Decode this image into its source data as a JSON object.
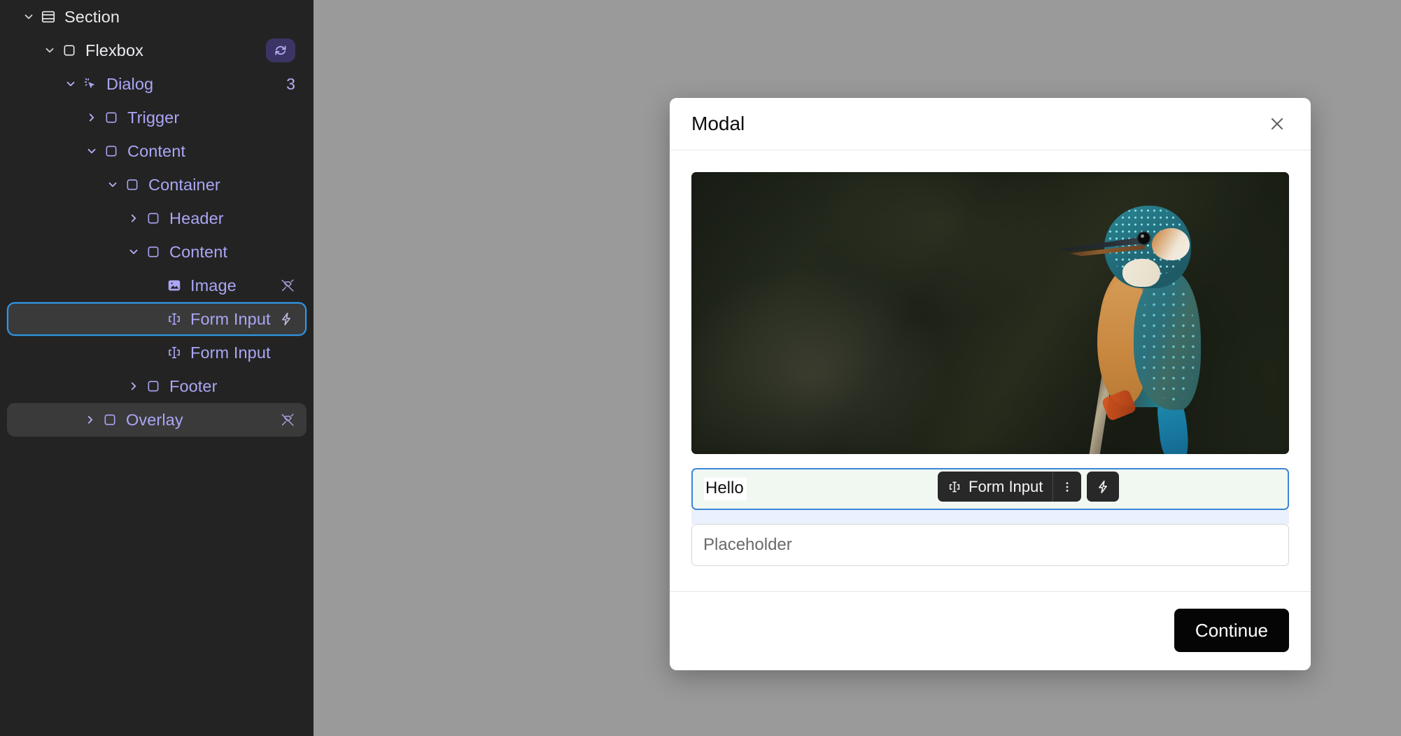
{
  "sidebar": {
    "tree": [
      {
        "label": "Section",
        "icon": "section-icon",
        "twisty": "down",
        "indent": 0,
        "state": "root",
        "trailing": null,
        "count": null
      },
      {
        "label": "Flexbox",
        "icon": "box-icon",
        "twisty": "down",
        "indent": 1,
        "state": "normal",
        "trailing": "refresh-badge",
        "count": null
      },
      {
        "label": "Dialog",
        "icon": "cursor-click-icon",
        "twisty": "down",
        "indent": 2,
        "state": "normal",
        "trailing": null,
        "count": "3"
      },
      {
        "label": "Trigger",
        "icon": "box-icon",
        "twisty": "right",
        "indent": 3,
        "state": "normal",
        "trailing": null,
        "count": null
      },
      {
        "label": "Content",
        "icon": "box-icon",
        "twisty": "down",
        "indent": 3,
        "state": "normal",
        "trailing": null,
        "count": null
      },
      {
        "label": "Container",
        "icon": "box-icon",
        "twisty": "down",
        "indent": 4,
        "state": "normal",
        "trailing": null,
        "count": null
      },
      {
        "label": "Header",
        "icon": "box-icon",
        "twisty": "right",
        "indent": 5,
        "state": "normal",
        "trailing": null,
        "count": null
      },
      {
        "label": "Content",
        "icon": "box-icon",
        "twisty": "down",
        "indent": 5,
        "state": "normal",
        "trailing": null,
        "count": null
      },
      {
        "label": "Image",
        "icon": "image-icon",
        "twisty": "none",
        "indent": 6,
        "state": "normal",
        "trailing": "unplug-icon",
        "count": null
      },
      {
        "label": "Form Input",
        "icon": "form-input-icon",
        "twisty": "none",
        "indent": 6,
        "state": "selected",
        "trailing": "bolt-icon",
        "count": null
      },
      {
        "label": "Form Input",
        "icon": "form-input-icon",
        "twisty": "none",
        "indent": 6,
        "state": "normal",
        "trailing": null,
        "count": null
      },
      {
        "label": "Footer",
        "icon": "box-icon",
        "twisty": "right",
        "indent": 5,
        "state": "normal",
        "trailing": null,
        "count": null
      },
      {
        "label": "Overlay",
        "icon": "box-icon",
        "twisty": "right",
        "indent": 3,
        "state": "hovered",
        "trailing": "unplug-icon",
        "count": null
      }
    ]
  },
  "canvas": {
    "background_color": "#9a9a9a",
    "guide_color": "#6a6ad1"
  },
  "modal": {
    "title": "Modal",
    "close_label": "×",
    "image": {
      "alt": "Common kingfisher perched on a branch",
      "subject": "kingfisher-photo"
    },
    "float_bar": {
      "label": "Form Input",
      "icon": "form-input-icon",
      "menu_icon": "kebab-menu-icon",
      "action_icon": "bolt-icon"
    },
    "fields": [
      {
        "name": "first-input",
        "value": "Hello",
        "placeholder": "",
        "focused": true
      },
      {
        "name": "second-input",
        "value": "Placeholder",
        "placeholder": "Placeholder",
        "focused": false
      }
    ],
    "footer": {
      "primary_button": "Continue"
    }
  },
  "colors": {
    "sidebar_bg": "#232323",
    "tree_text": "#aaa6f5",
    "selection_border": "#2f97e8",
    "accent_purple": "#3b3565",
    "focus_border": "#3b86d6",
    "button_bg": "#050505"
  }
}
